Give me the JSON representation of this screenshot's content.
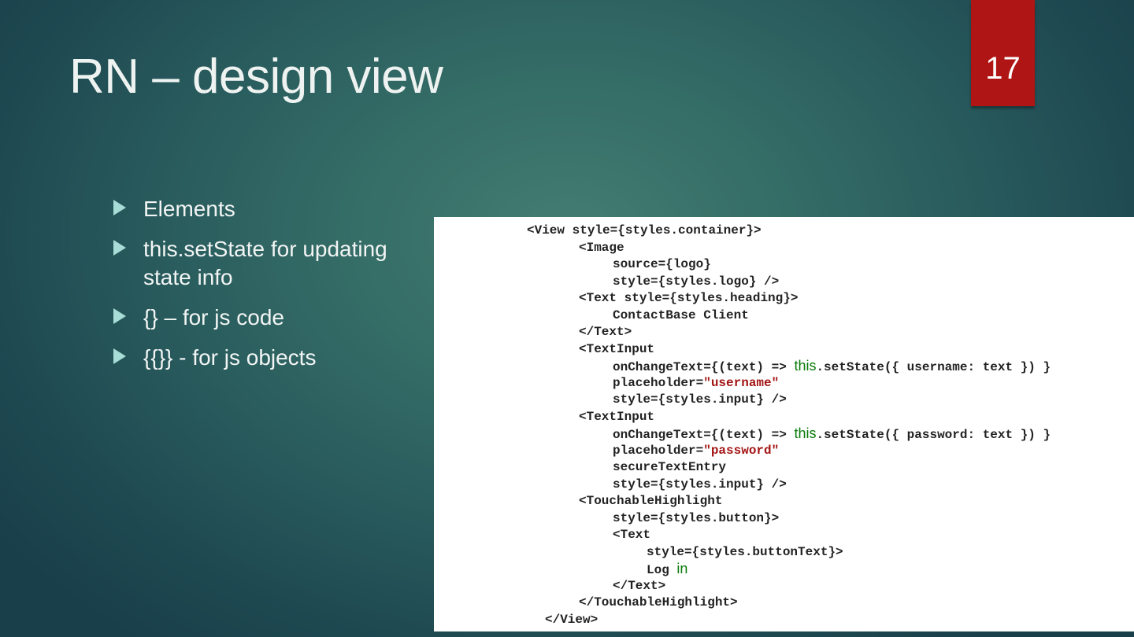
{
  "slide": {
    "title": "RN – design view",
    "number": "17"
  },
  "bullets": [
    {
      "text": "Elements"
    },
    {
      "text": "this.setState for updating state info"
    },
    {
      "text": "{} – for js code"
    },
    {
      "text": "{{}} - for js objects"
    }
  ],
  "code": {
    "lines": [
      {
        "text": "<View style={styles.container}>"
      },
      {
        "text": "<Image"
      },
      {
        "text": "source={logo}"
      },
      {
        "text": "style={styles.logo} />"
      },
      {
        "text": "<Text style={styles.heading}>"
      },
      {
        "text": "ContactBase Client"
      },
      {
        "text": "</Text>"
      },
      {
        "text": "<TextInput"
      },
      {
        "pre": "onChangeText={(text) => ",
        "kw": "this",
        "post": ".setState({ username: text }) }"
      },
      {
        "pre": "placeholder=",
        "str": "\"username\""
      },
      {
        "text": "style={styles.input} />"
      },
      {
        "text": "<TextInput"
      },
      {
        "pre": "onChangeText={(text) => ",
        "kw": "this",
        "post": ".setState({ password: text }) }"
      },
      {
        "pre": "placeholder=",
        "str": "\"password\""
      },
      {
        "text": "secureTextEntry"
      },
      {
        "text": "style={styles.input} />"
      },
      {
        "text": "<TouchableHighlight"
      },
      {
        "text": "style={styles.button}>"
      },
      {
        "text": "<Text"
      },
      {
        "text": "style={styles.buttonText}>"
      },
      {
        "pre": "Log ",
        "kw": "in"
      },
      {
        "text": "</Text>"
      },
      {
        "text": "</TouchableHighlight>"
      },
      {
        "text": "</View>"
      }
    ]
  },
  "colors": {
    "slide_number_bg": "#b01515",
    "bullet_icon": "#a8dcd6",
    "keyword": "#0a7a0a",
    "string": "#a31515"
  }
}
